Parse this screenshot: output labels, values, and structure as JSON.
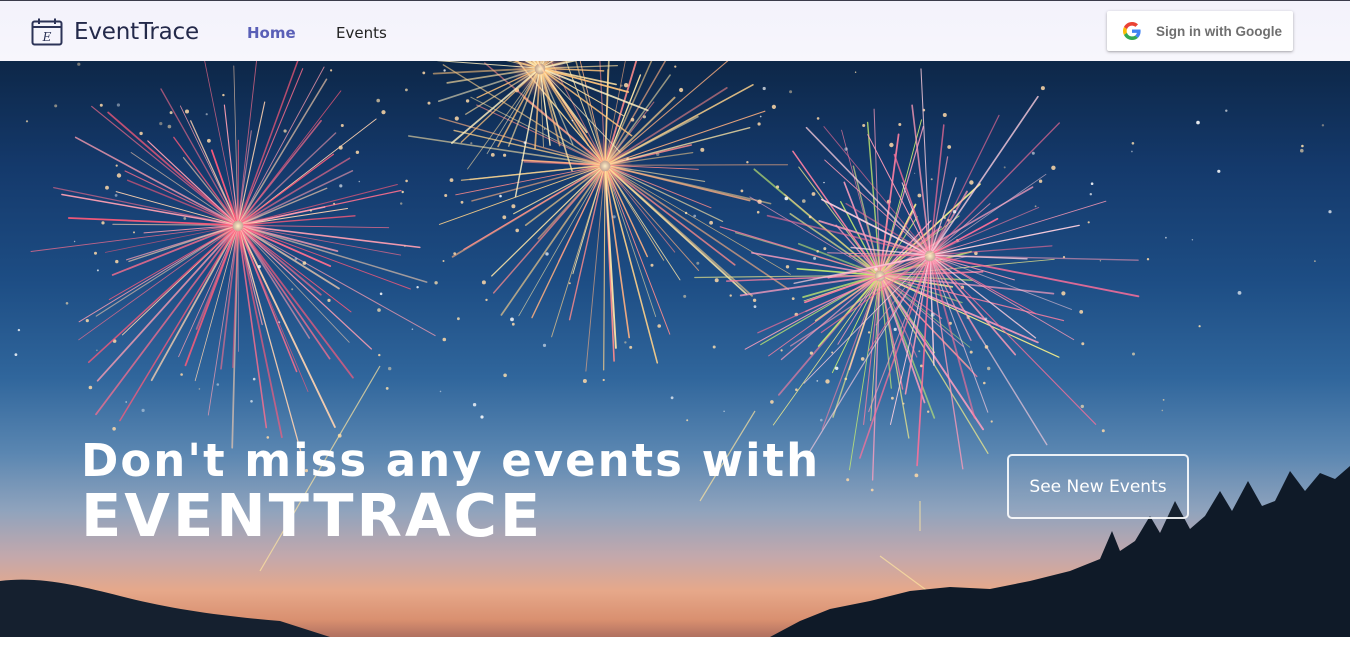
{
  "brand": {
    "name": "EventTrace",
    "icon": "calendar-icon",
    "icon_letter": "E"
  },
  "nav": {
    "items": [
      {
        "label": "Home",
        "active": true
      },
      {
        "label": "Events",
        "active": false
      }
    ]
  },
  "auth": {
    "google_button_label": "Sign in with Google",
    "icon": "google-g-icon"
  },
  "hero": {
    "headline_line1": "Don't miss any events with",
    "headline_line2": "EVENTTRACE",
    "cta_label": "See New Events",
    "background_image": "fireworks-night-sky"
  },
  "colors": {
    "accent": "#5a5fb7",
    "brand_text": "#23294a",
    "navbar_bg": "#f5f4fb",
    "hero_text": "#ffffff"
  }
}
